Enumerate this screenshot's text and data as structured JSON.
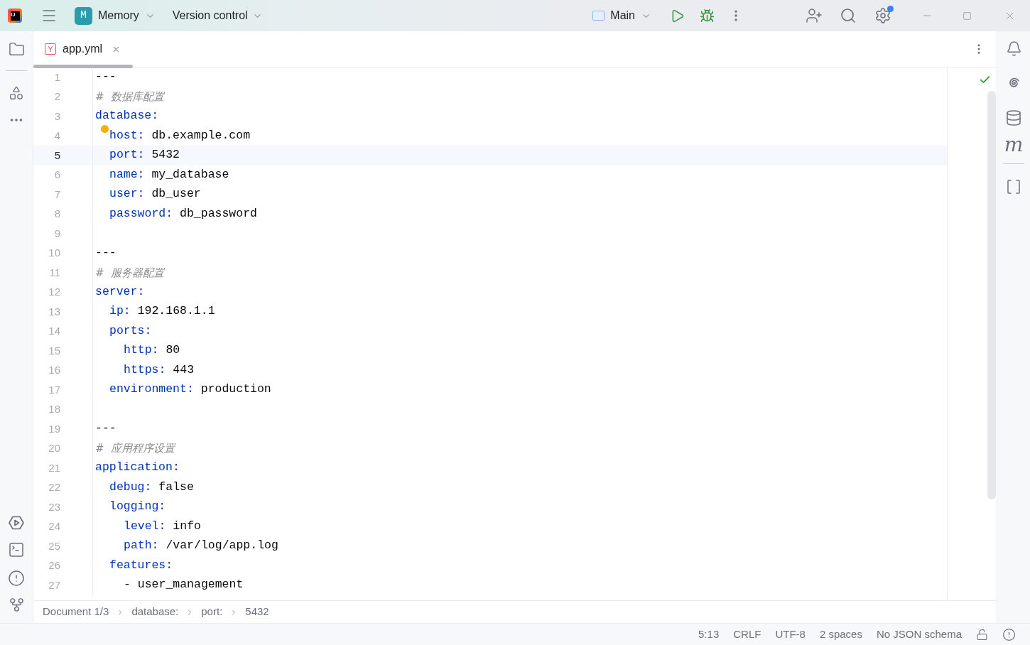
{
  "title_bar": {
    "logo_text": "IJ",
    "project_badge": "M",
    "project": "Memory",
    "vcs": "Version control",
    "run_config": "Main"
  },
  "tab": {
    "icon_letter": "Y",
    "label": "app.yml",
    "selected": true
  },
  "lines": [
    {
      "number": "1",
      "kind": "plain",
      "text": "---",
      "selected": false,
      "bulb": false
    },
    {
      "number": "2",
      "kind": "comment",
      "text": "#  数据库配置",
      "selected": false,
      "bulb": false
    },
    {
      "number": "3",
      "kind": "key",
      "key": "database:",
      "selected": false,
      "bulb": false,
      "children": [
        {
          "number": "4",
          "kind": "key",
          "key": "host:",
          "value": "db.example.com",
          "selected": false,
          "bulb": true
        },
        {
          "number": "5",
          "kind": "key",
          "key": "port:",
          "value": "5432",
          "selected": true,
          "bulb": false
        },
        {
          "number": "6",
          "kind": "key",
          "key": "name:",
          "value": "my_database",
          "selected": false,
          "bulb": false
        },
        {
          "number": "7",
          "kind": "key",
          "key": "user:",
          "value": "db_user",
          "selected": false,
          "bulb": false
        },
        {
          "number": "8",
          "kind": "key",
          "key": "password:",
          "value": "db_password",
          "selected": false,
          "bulb": false
        }
      ]
    },
    {
      "number": "9",
      "kind": "blank",
      "selected": false,
      "bulb": false
    },
    {
      "number": "10",
      "kind": "plain",
      "text": "---",
      "selected": false,
      "bulb": false
    },
    {
      "number": "11",
      "kind": "comment",
      "text": "#  服务器配置",
      "selected": false,
      "bulb": false
    },
    {
      "number": "12",
      "kind": "key",
      "key": "server:",
      "selected": false,
      "bulb": false,
      "children": [
        {
          "number": "13",
          "kind": "key",
          "key": "ip:",
          "value": "192.168.1.1",
          "selected": false,
          "bulb": false
        },
        {
          "number": "14",
          "kind": "key",
          "key": "ports:",
          "selected": false,
          "bulb": false,
          "children": [
            {
              "number": "15",
              "kind": "key",
              "key": "http:",
              "value": "80",
              "selected": false,
              "bulb": false
            },
            {
              "number": "16",
              "kind": "key",
              "key": "https:",
              "value": "443",
              "selected": false,
              "bulb": false
            }
          ]
        },
        {
          "number": "17",
          "kind": "key",
          "key": "environment:",
          "value": "production",
          "selected": false,
          "bulb": false
        }
      ]
    },
    {
      "number": "18",
      "kind": "blank",
      "selected": false,
      "bulb": false
    },
    {
      "number": "19",
      "kind": "plain",
      "text": "---",
      "selected": false,
      "bulb": false
    },
    {
      "number": "20",
      "kind": "comment",
      "text": "#  应用程序设置",
      "selected": false,
      "bulb": false
    },
    {
      "number": "21",
      "kind": "key",
      "key": "application:",
      "selected": false,
      "bulb": false,
      "children": [
        {
          "number": "22",
          "kind": "key",
          "key": "debug:",
          "value": "false",
          "selected": false,
          "bulb": false
        },
        {
          "number": "23",
          "kind": "key",
          "key": "logging:",
          "selected": false,
          "bulb": false,
          "children": [
            {
              "number": "24",
              "kind": "key",
              "key": "level:",
              "value": "info",
              "selected": false,
              "bulb": false
            },
            {
              "number": "25",
              "kind": "key",
              "key": "path:",
              "value": "/var/log/app.log",
              "selected": false,
              "bulb": false
            }
          ]
        },
        {
          "number": "26",
          "kind": "key",
          "key": "features:",
          "selected": false,
          "bulb": false,
          "children": [
            {
              "number": "27",
              "kind": "plain",
              "text": "- user_management",
              "selected": false,
              "bulb": false
            }
          ]
        }
      ]
    }
  ],
  "right_toolbar": {
    "glyph": "m"
  },
  "breadcrumbs": [
    "Document 1/3",
    "database:",
    "port:",
    "5432"
  ],
  "status_bar": {
    "position": "5:13",
    "line_separator": "CRLF",
    "encoding": "UTF-8",
    "indent": "2 spaces",
    "schema": "No JSON schema"
  }
}
